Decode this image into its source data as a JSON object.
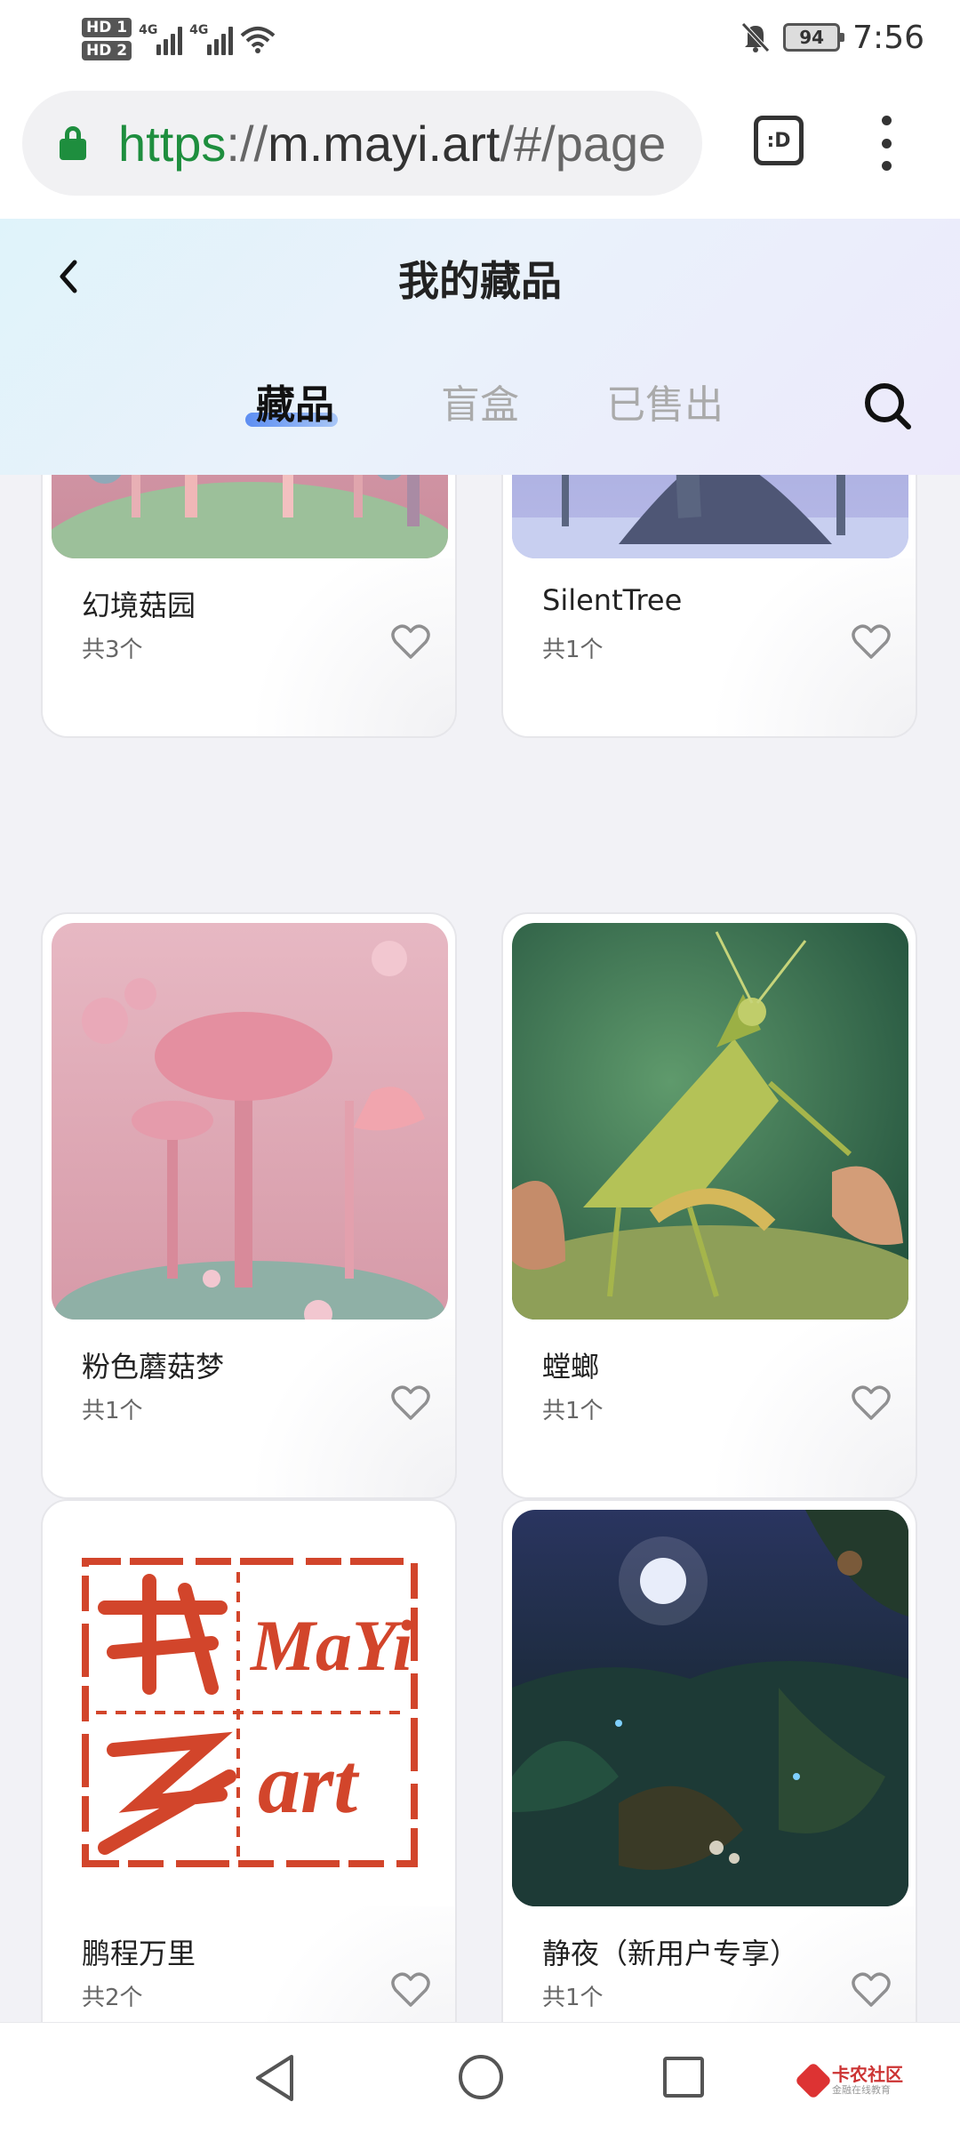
{
  "status_bar": {
    "hd_badges": [
      "HD 1",
      "HD 2"
    ],
    "network_labels": [
      "4G",
      "4G"
    ],
    "battery": "94",
    "time": "7:56",
    "icons": [
      "signal-icon",
      "wifi-icon",
      "mute-bell-icon",
      "battery-icon"
    ]
  },
  "browser": {
    "url_scheme": "https",
    "url_separator": "://",
    "url_host": "m.mayi.art",
    "url_rest": "/#/page",
    "tab_switch_label": ":D",
    "icons": [
      "lock-icon",
      "tab-switcher-icon",
      "overflow-menu-icon"
    ]
  },
  "header": {
    "title": "我的藏品",
    "tabs": [
      {
        "label": "藏品",
        "active": true
      },
      {
        "label": "盲盒",
        "active": false
      },
      {
        "label": "已售出",
        "active": false
      }
    ],
    "icons": [
      "back-icon",
      "search-icon"
    ]
  },
  "collections": [
    {
      "name": "幻境菇园",
      "count": "共3个",
      "art": "pastel-mushroom-garden"
    },
    {
      "name": "SilentTree",
      "count": "共1个",
      "art": "blue-crystal-tree"
    },
    {
      "name": "粉色蘑菇梦",
      "count": "共1个",
      "art": "pink-mushroom-dream"
    },
    {
      "name": "螳螂",
      "count": "共1个",
      "art": "mantis"
    },
    {
      "name": "鹏程万里",
      "count": "共2个",
      "art": "mayi-art-seal",
      "seal_text": [
        "MaYi",
        "art"
      ]
    },
    {
      "name": "静夜（新用户专享）",
      "count": "共1个",
      "art": "night-jungle"
    }
  ],
  "nav": {
    "icons": [
      "nav-back-icon",
      "nav-home-icon",
      "nav-recent-icon"
    ],
    "watermark_main": "卡农社区",
    "watermark_sub": "金融在线教育"
  },
  "colors": {
    "accent_green": "#1e8e3e",
    "tab_indicator": "#5d8ef2",
    "seal_red": "#d2452b"
  }
}
